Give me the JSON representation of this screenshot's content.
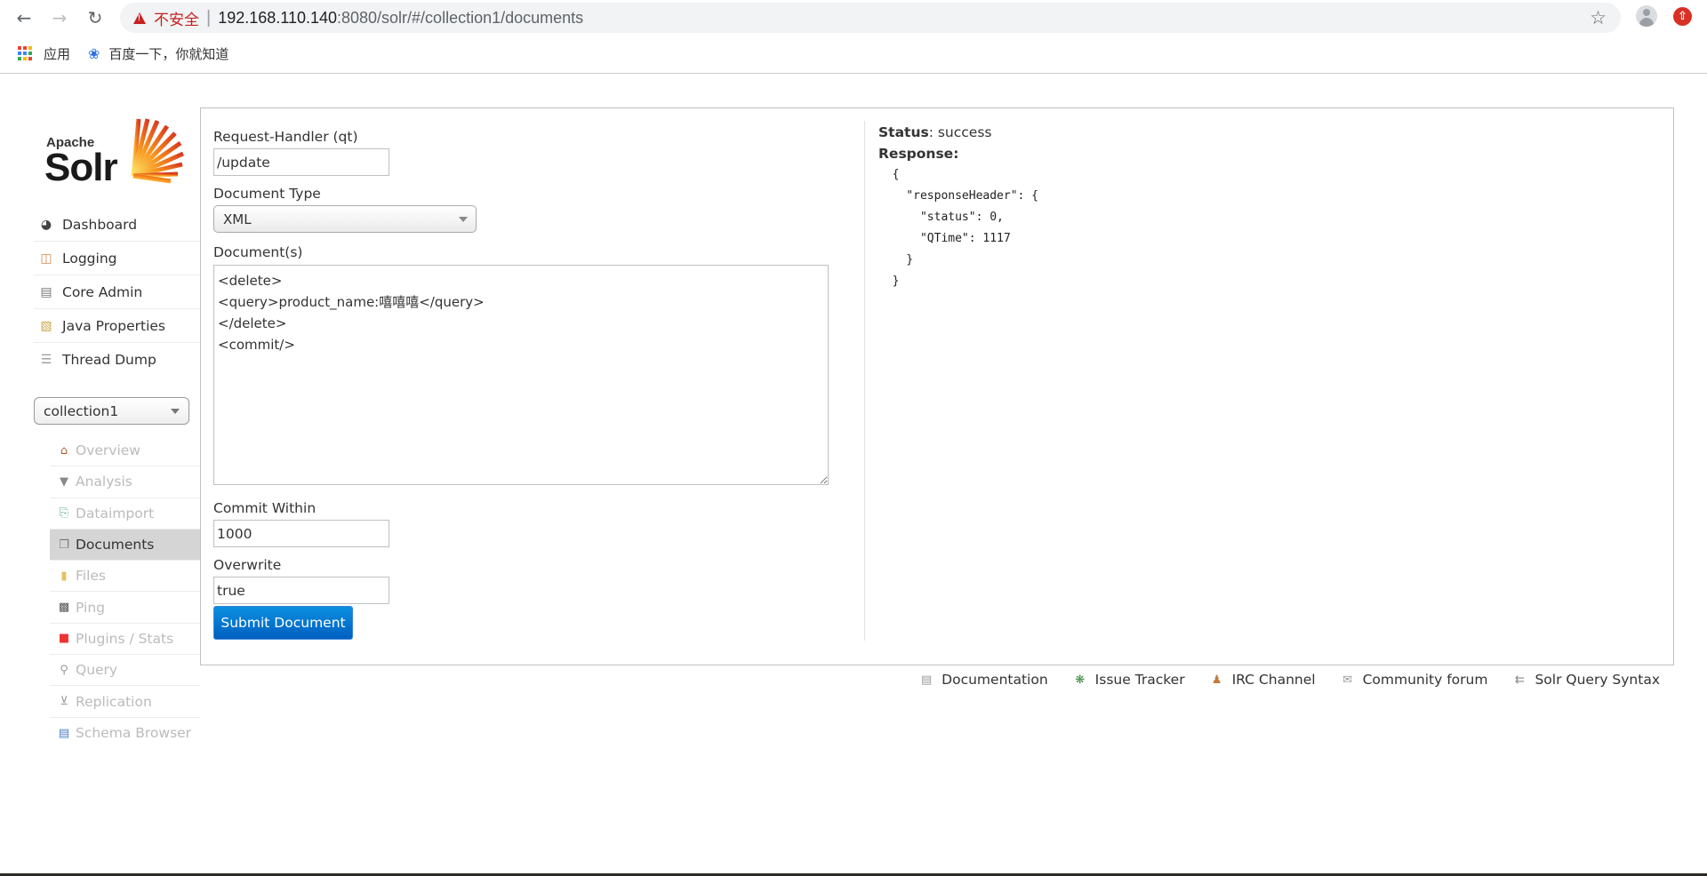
{
  "browser": {
    "security_label": "不安全",
    "url_host": "192.168.110.140",
    "url_path": ":8080/solr/#/collection1/documents",
    "bookmarks": [
      {
        "label": "应用",
        "icon": "apps-grid-icon"
      },
      {
        "label": "百度一下，你就知道",
        "icon": "baidu-paw-icon"
      }
    ]
  },
  "logo": {
    "apache": "Apache",
    "solr": "Solr"
  },
  "menu": [
    {
      "label": "Dashboard",
      "icon": "dashboard-gauge-icon"
    },
    {
      "label": "Logging",
      "icon": "logging-tray-icon"
    },
    {
      "label": "Core Admin",
      "icon": "core-admin-server-icon"
    },
    {
      "label": "Java Properties",
      "icon": "java-jar-icon"
    },
    {
      "label": "Thread Dump",
      "icon": "thread-dump-stack-icon"
    }
  ],
  "core_selector": {
    "selected": "collection1"
  },
  "core_menu": [
    {
      "label": "Overview",
      "icon": "house-icon",
      "active": false
    },
    {
      "label": "Analysis",
      "icon": "funnel-icon",
      "active": false
    },
    {
      "label": "Dataimport",
      "icon": "import-doc-icon",
      "active": false
    },
    {
      "label": "Documents",
      "icon": "documents-icon",
      "active": true
    },
    {
      "label": "Files",
      "icon": "folder-icon",
      "active": false
    },
    {
      "label": "Ping",
      "icon": "monitor-pulse-icon",
      "active": false
    },
    {
      "label": "Plugins / Stats",
      "icon": "plugin-blocks-icon",
      "active": false
    },
    {
      "label": "Query",
      "icon": "magnifier-icon",
      "active": false
    },
    {
      "label": "Replication",
      "icon": "replication-nodes-icon",
      "active": false
    },
    {
      "label": "Schema Browser",
      "icon": "book-icon",
      "active": false
    }
  ],
  "form": {
    "request_handler_label": "Request-Handler (qt)",
    "request_handler_value": "/update",
    "document_type_label": "Document Type",
    "document_type_value": "XML",
    "documents_label": "Document(s)",
    "documents_value": "<delete>\n<query>product_name:嘻嘻嘻</query>\n</delete>\n<commit/>",
    "commit_within_label": "Commit Within",
    "commit_within_value": "1000",
    "overwrite_label": "Overwrite",
    "overwrite_value": "true",
    "submit_label": "Submit Document"
  },
  "response": {
    "status_label": "Status",
    "status_value": ": success",
    "response_label": "Response:",
    "json_text": "  {\n    \"responseHeader\": {\n      \"status\": 0,\n      \"QTime\": 1117\n    }\n  }"
  },
  "footer": [
    {
      "label": "Documentation",
      "icon": "document-icon"
    },
    {
      "label": "Issue Tracker",
      "icon": "bug-icon"
    },
    {
      "label": "IRC Channel",
      "icon": "people-icon"
    },
    {
      "label": "Community forum",
      "icon": "envelope-icon"
    },
    {
      "label": "Solr Query Syntax",
      "icon": "query-syntax-icon"
    }
  ]
}
